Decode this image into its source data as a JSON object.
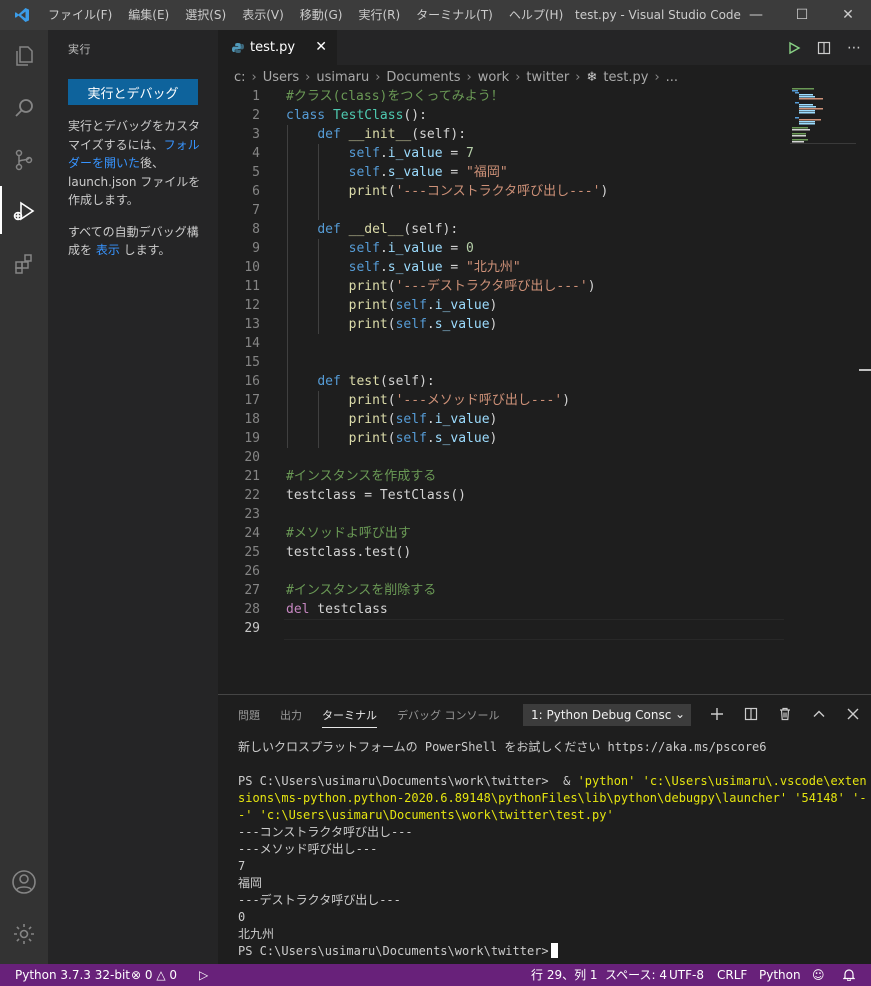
{
  "titlebar": {
    "menu": [
      "ファイル(F)",
      "編集(E)",
      "選択(S)",
      "表示(V)",
      "移動(G)",
      "実行(R)",
      "ターミナル(T)",
      "ヘルプ(H)"
    ],
    "title": "test.py - Visual Studio Code"
  },
  "sidebar": {
    "title": "実行",
    "run_button": "実行とデバッグ",
    "text1_a": "実行とデバッグをカスタマイズするには、",
    "text1_link": "フォルダーを開いた",
    "text1_b": "後、launch.json ファイルを作成します。",
    "text2_a": "すべての自動デバッグ構成を ",
    "text2_link": "表示",
    "text2_b": " します。"
  },
  "tab": {
    "label": "test.py"
  },
  "breadcrumb": {
    "parts": [
      "c:",
      "Users",
      "usimaru",
      "Documents",
      "work",
      "twitter"
    ],
    "file": "test.py",
    "trail": "..."
  },
  "editor": {
    "line_numbers": [
      "1",
      "2",
      "3",
      "4",
      "5",
      "6",
      "7",
      "8",
      "9",
      "10",
      "11",
      "12",
      "13",
      "14",
      "15",
      "16",
      "17",
      "18",
      "19",
      "20",
      "21",
      "22",
      "23",
      "24",
      "25",
      "26",
      "27",
      "28",
      "29"
    ],
    "code": {
      "l1": "#クラス(class)をつくってみよう！",
      "l2_kw": "class",
      "l2_name": "TestClass",
      "l2_rest": "():",
      "def": "def",
      "init": "__init__",
      "del_fn": "__del__",
      "test_fn": "test",
      "self": "self",
      "params": "(self):",
      "i_value": "i_value",
      "s_value": "s_value",
      "eq": " = ",
      "v7": "7",
      "v0": "0",
      "fukuoka": "\"福岡\"",
      "kitakyushu": "\"北九州\"",
      "print": "print",
      "s_ctor": "'---コンストラクタ呼び出し---'",
      "s_dtor": "'---デストラクタ呼び出し---'",
      "s_method": "'---メソッド呼び出し---'",
      "c21": "#インスタンスを作成する",
      "l22": "testclass = TestClass()",
      "c24": "#メソッドよ呼び出す",
      "l25": "testclass.test()",
      "c27": "#インスタンスを削除する",
      "del_kw": "del",
      "l28_rest": " testclass"
    }
  },
  "panel": {
    "tabs": [
      "問題",
      "出力",
      "ターミナル",
      "デバッグ コンソール"
    ],
    "select": "1: Python Debug Consc",
    "terminal": {
      "l1": "新しいクロスプラットフォームの PowerShell をお試しください https://aka.ms/pscore6",
      "prompt": "PS C:\\Users\\usimaru\\Documents\\work\\twitter> ",
      "cmd": " & ",
      "cmd_y1": "'python' 'c:\\Users\\usimaru\\.vscode\\exten",
      "l4": "sions\\ms-python.python-2020.6.89148\\pythonFiles\\lib\\python\\debugpy\\launcher' '54148' '-",
      "l5": "-' 'c:\\Users\\usimaru\\Documents\\work\\twitter\\test.py'",
      "o1": "---コンストラクタ呼び出し---",
      "o2": "---メソッド呼び出し---",
      "o3": "7",
      "o4": "福岡",
      "o5": "---デストラクタ呼び出し---",
      "o6": "0",
      "o7": "北九州",
      "last_prompt": "PS C:\\Users\\usimaru\\Documents\\work\\twitter>"
    }
  },
  "statusbar": {
    "python": "Python 3.7.3 32-bit",
    "errors": "0",
    "warnings": "0",
    "position": "行 29、列 1",
    "spaces": "スペース: 4",
    "encoding": "UTF-8",
    "eol": "CRLF",
    "language": "Python",
    "color": "#68217a"
  }
}
